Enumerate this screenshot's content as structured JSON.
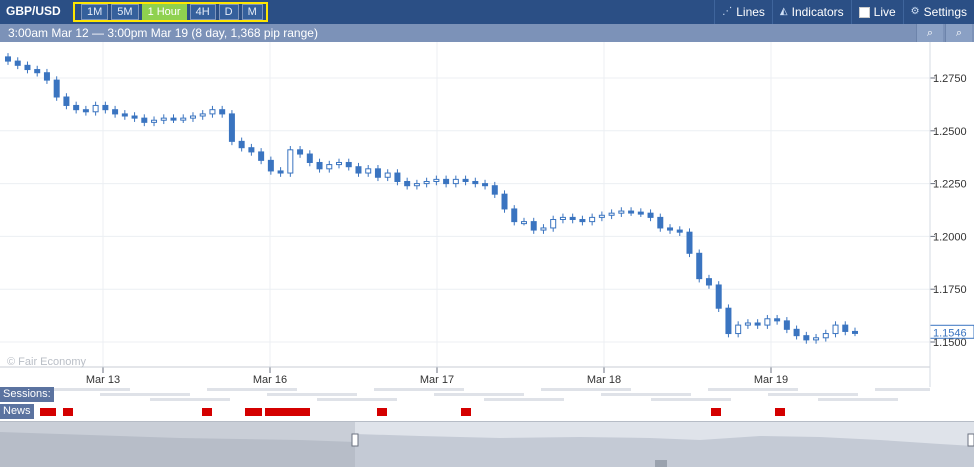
{
  "toolbar": {
    "symbol": "GBP/USD",
    "timeframes": [
      "1M",
      "5M",
      "1 Hour",
      "4H",
      "D",
      "M"
    ],
    "active_timeframe": "1 Hour",
    "lines_label": "Lines",
    "indicators_label": "Indicators",
    "live_label": "Live",
    "settings_label": "Settings"
  },
  "range_bar": {
    "text": "3:00am Mar 12 — 3:00pm Mar 19 (8 day, 1,368 pip range)"
  },
  "copyright": "© Fair Economy",
  "sessions_label": "Sessions:",
  "news_label": "News",
  "colors": {
    "toolbar_bg": "#2b4f85",
    "accent_yellow": "#ffe600",
    "active_green": "#8fd14f",
    "candle_blue": "#3a74c0",
    "news_red": "#d40000"
  },
  "chart_data": {
    "type": "candlestick",
    "x_tick_labels": [
      "Mar 13",
      "Mar 16",
      "Mar 17",
      "Mar 18",
      "Mar 19"
    ],
    "y_tick_labels": [
      "1.2750",
      "1.2500",
      "1.2250",
      "1.2000",
      "1.1750",
      "1.1500"
    ],
    "ylim": [
      1.15,
      1.295
    ],
    "current_price": "1.1546",
    "grid": true,
    "close_series": [
      1.283,
      1.281,
      1.279,
      1.2775,
      1.274,
      1.266,
      1.262,
      1.26,
      1.259,
      1.262,
      1.26,
      1.258,
      1.257,
      1.256,
      1.254,
      1.255,
      1.256,
      1.2555,
      1.256,
      1.257,
      1.258,
      1.26,
      1.258,
      1.245,
      1.242,
      1.24,
      1.236,
      1.231,
      1.23,
      1.241,
      1.239,
      1.235,
      1.232,
      1.234,
      1.235,
      1.233,
      1.23,
      1.232,
      1.228,
      1.23,
      1.226,
      1.224,
      1.225,
      1.226,
      1.227,
      1.225,
      1.227,
      1.226,
      1.225,
      1.224,
      1.22,
      1.213,
      1.207,
      1.207,
      1.203,
      1.204,
      1.208,
      1.209,
      1.208,
      1.207,
      1.209,
      1.21,
      1.211,
      1.212,
      1.2115,
      1.211,
      1.209,
      1.204,
      1.203,
      1.202,
      1.192,
      1.18,
      1.177,
      1.166,
      1.154,
      1.158,
      1.159,
      1.158,
      1.161,
      1.16,
      1.156,
      1.153,
      1.151,
      1.152,
      1.154,
      1.158,
      1.155,
      1.1546
    ]
  }
}
